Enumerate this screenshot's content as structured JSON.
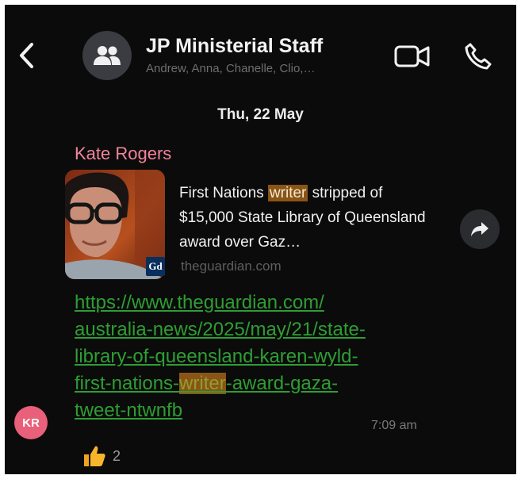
{
  "header": {
    "title": "JP Ministerial Staff",
    "members": "Andrew, Anna, Chanelle, Clio,…",
    "icons": {
      "back": "chevron-left-icon",
      "group": "group-icon",
      "video": "video-camera-icon",
      "phone": "phone-icon"
    }
  },
  "date_divider": "Thu, 22 May",
  "message": {
    "sender": "Kate Rogers",
    "sender_color": "#f2839b",
    "avatar_initials": "KR",
    "avatar_color": "#e8607a",
    "preview": {
      "title_before": "First Nations ",
      "title_highlight": "writer",
      "title_after": " stripped of $15,000 State Library of Queensland award over Gaz…",
      "source_logo": "Gd",
      "domain": "theguardian.com"
    },
    "link_lines": [
      "https://www.theguardian.com/",
      "australia-news/2025/may/21/state-",
      "library-of-queensland-karen-wyld-"
    ],
    "link_line4_before": "first-nations-",
    "link_line4_highlight": "writer",
    "link_line4_after": "-award-gaza-",
    "link_line5": "tweet-ntwnfb",
    "time": "7:09 am",
    "reaction": {
      "emoji": "thumbs-up-icon",
      "count": "2"
    }
  },
  "colors": {
    "background": "#0b0b0b",
    "link": "#2e9e33",
    "highlight": "#8a5416"
  }
}
